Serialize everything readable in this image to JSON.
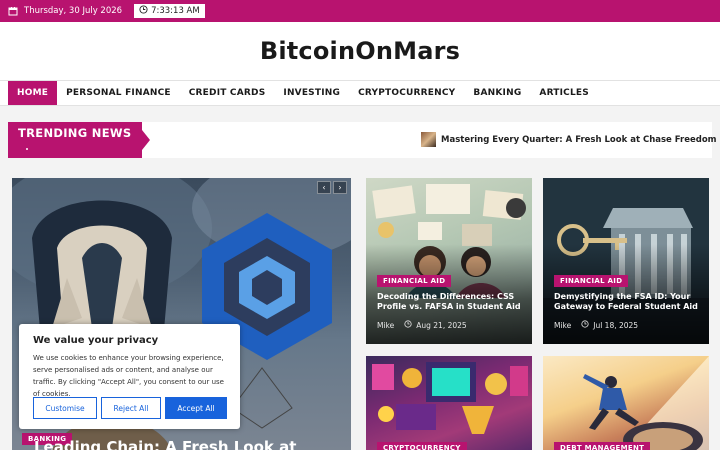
{
  "topbar": {
    "date": "Thursday, 30 July 2026",
    "time": "7:33:13 AM",
    "calendar_icon": "calendar-icon",
    "clock_icon": "clock-icon",
    "bg_color": "#b8136f"
  },
  "header": {
    "site_title": "BitcoinOnMars"
  },
  "nav": {
    "items": [
      "HOME",
      "PERSONAL FINANCE",
      "CREDIT CARDS",
      "INVESTING",
      "CRYPTOCURRENCY",
      "BANKING",
      "ARTICLES"
    ],
    "active": "HOME"
  },
  "trending": {
    "label": "TRENDING NEWS",
    "headline": "Mastering Every Quarter: A Fresh Look at Chase Freedom Flex's"
  },
  "feature": {
    "category": "BANKING",
    "title": "Leading Chain: A Fresh Look at",
    "prev_icon": "chevron-left-icon",
    "next_icon": "chevron-right-icon"
  },
  "cards": [
    {
      "category": "FINANCIAL AID",
      "title": "Decoding the Differences: CSS Profile vs. FAFSA in Student Aid",
      "author": "Mike",
      "date": "Aug 21, 2025"
    },
    {
      "category": "FINANCIAL AID",
      "title": "Demystifying the FSA ID: Your Gateway to Federal Student Aid",
      "author": "Mike",
      "date": "Jul 18, 2025"
    },
    {
      "category": "CRYPTOCURRENCY",
      "title": "",
      "author": "",
      "date": ""
    },
    {
      "category": "DEBT MANAGEMENT",
      "title": "",
      "author": "",
      "date": ""
    }
  ],
  "cookie": {
    "heading": "We value your privacy",
    "body": "We use cookies to enhance your browsing experience, serve personalised ads or content, and analyse our traffic. By clicking \"Accept All\", you consent to our use of cookies.",
    "customise": "Customise",
    "reject": "Reject All",
    "accept": "Accept All",
    "button_color": "#1863dc"
  }
}
